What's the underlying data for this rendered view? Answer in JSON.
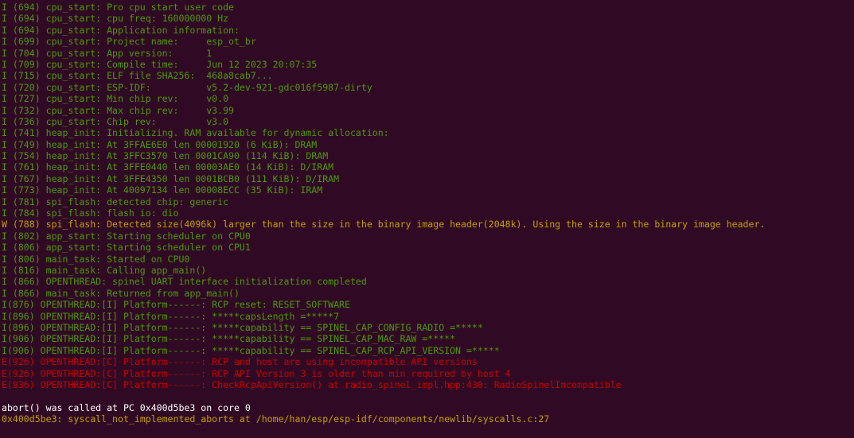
{
  "terminal": {
    "colors": {
      "background": "#300a24",
      "info": "#4e9a06",
      "warning": "#c4a000",
      "error": "#cc0000",
      "plain": "#ffffff"
    },
    "lines": [
      {
        "level": "I",
        "text": "I (694) cpu_start: Pro cpu start user code"
      },
      {
        "level": "I",
        "text": "I (694) cpu_start: cpu freq: 160000000 Hz"
      },
      {
        "level": "I",
        "text": "I (694) cpu_start: Application information:"
      },
      {
        "level": "I",
        "text": "I (699) cpu_start: Project name:     esp_ot_br"
      },
      {
        "level": "I",
        "text": "I (704) cpu_start: App version:      1"
      },
      {
        "level": "I",
        "text": "I (709) cpu_start: Compile time:     Jun 12 2023 20:07:35"
      },
      {
        "level": "I",
        "text": "I (715) cpu_start: ELF file SHA256:  468a8cab7..."
      },
      {
        "level": "I",
        "text": "I (720) cpu_start: ESP-IDF:          v5.2-dev-921-gdc016f5987-dirty"
      },
      {
        "level": "I",
        "text": "I (727) cpu_start: Min chip rev:     v0.0"
      },
      {
        "level": "I",
        "text": "I (732) cpu_start: Max chip rev:     v3.99"
      },
      {
        "level": "I",
        "text": "I (736) cpu_start: Chip rev:         v3.0"
      },
      {
        "level": "I",
        "text": "I (741) heap_init: Initializing. RAM available for dynamic allocation:"
      },
      {
        "level": "I",
        "text": "I (749) heap_init: At 3FFAE6E0 len 00001920 (6 KiB): DRAM"
      },
      {
        "level": "I",
        "text": "I (754) heap_init: At 3FFC3570 len 0001CA90 (114 KiB): DRAM"
      },
      {
        "level": "I",
        "text": "I (761) heap_init: At 3FFE0440 len 00003AE0 (14 KiB): D/IRAM"
      },
      {
        "level": "I",
        "text": "I (767) heap_init: At 3FFE4350 len 0001BCB0 (111 KiB): D/IRAM"
      },
      {
        "level": "I",
        "text": "I (773) heap_init: At 40097134 len 00008ECC (35 KiB): IRAM"
      },
      {
        "level": "I",
        "text": "I (781) spi_flash: detected chip: generic"
      },
      {
        "level": "I",
        "text": "I (784) spi_flash: flash io: dio"
      },
      {
        "level": "W",
        "text": "W (788) spi_flash: Detected size(4096k) larger than the size in the binary image header(2048k). Using the size in the binary image header."
      },
      {
        "level": "I",
        "text": "I (802) app_start: Starting scheduler on CPU0"
      },
      {
        "level": "I",
        "text": "I (806) app_start: Starting scheduler on CPU1"
      },
      {
        "level": "I",
        "text": "I (806) main_task: Started on CPU0"
      },
      {
        "level": "I",
        "text": "I (816) main_task: Calling app_main()"
      },
      {
        "level": "I",
        "text": "I (866) OPENTHREAD: spinel UART interface initialization completed"
      },
      {
        "level": "I",
        "text": "I (866) main_task: Returned from app_main()"
      },
      {
        "level": "I",
        "text": "I(876) OPENTHREAD:[I] Platform------: RCP reset: RESET_SOFTWARE"
      },
      {
        "level": "I",
        "text": "I(896) OPENTHREAD:[I] Platform------: *****capsLength =*****7"
      },
      {
        "level": "I",
        "text": "I(896) OPENTHREAD:[I] Platform------: *****capability == SPINEL_CAP_CONFIG_RADIO =*****"
      },
      {
        "level": "I",
        "text": "I(906) OPENTHREAD:[I] Platform------: *****capability == SPINEL_CAP_MAC_RAW =*****"
      },
      {
        "level": "I",
        "text": "I(906) OPENTHREAD:[I] Platform------: *****capability == SPINEL_CAP_RCP_API_VERSION =*****"
      },
      {
        "level": "E",
        "text": "E(926) OPENTHREAD:[C] Platform------: RCP and host are using incompatible API versions"
      },
      {
        "level": "E",
        "text": "E(926) OPENTHREAD:[C] Platform------: RCP API Version 3 is older than min required by host 4"
      },
      {
        "level": "E",
        "text": "E(936) OPENTHREAD:[C] Platform------: CheckRcpApiVersion() at radio_spinel_impl.hpp:430: RadioSpinelIncompatible"
      },
      {
        "level": "blank",
        "text": ""
      },
      {
        "level": "plain",
        "text": "abort() was called at PC 0x400d5be3 on core 0"
      },
      {
        "level": "addr",
        "text": "0x400d5be3: syscall_not_implemented_aborts at /home/han/esp/esp-idf/components/newlib/syscalls.c:27"
      }
    ]
  }
}
